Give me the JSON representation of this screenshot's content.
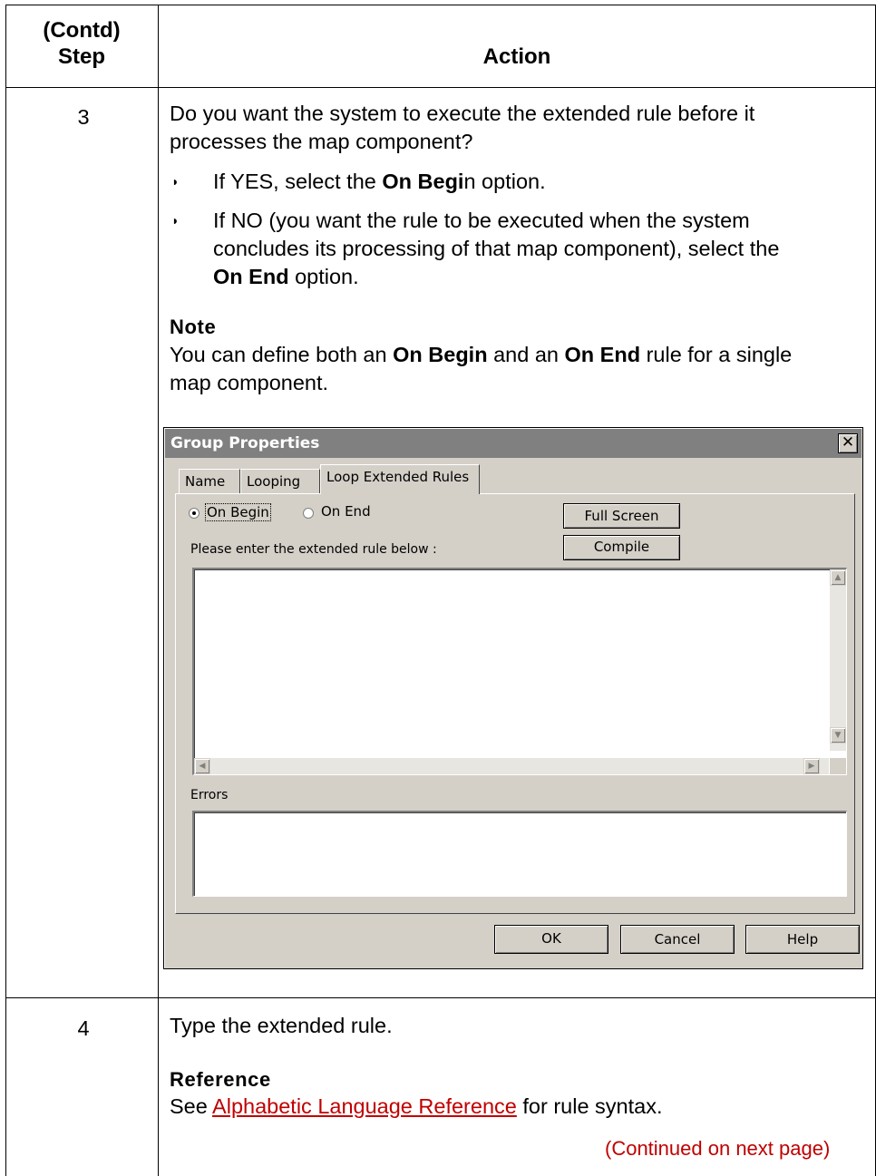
{
  "header": {
    "step_line1": "(Contd)",
    "step_line2": "Step",
    "action": "Action"
  },
  "row3": {
    "step": "3",
    "question_line1": "Do you want the system to execute the extended rule before it",
    "question_line2": "processes the map component?",
    "bullet1": {
      "prefix": "If YES, select the ",
      "bold": "On Begi",
      "suffix": "n option."
    },
    "bullet2": {
      "line1": "If NO (you want the rule to be executed when the system",
      "line2": "concludes its processing of that map component), select the",
      "bold": "On End",
      "suffix": " option."
    },
    "note": {
      "heading": "Note",
      "part1": "You can define both an ",
      "bold1": "On Begin",
      "part2": " and an ",
      "bold2": "On End",
      "part3": " rule for a single",
      "line2": "map component."
    }
  },
  "dialog": {
    "title": "Group Properties",
    "close_glyph": "✕",
    "tabs": [
      "Name",
      "Looping",
      "Loop Extended Rules"
    ],
    "radio_on_begin": "On Begin",
    "radio_on_end": "On End",
    "selected_radio": "On Begin",
    "full_screen_label": "Full Screen",
    "compile_label": "Compile",
    "rule_prompt": "Please enter the extended rule below :",
    "rule_value": "",
    "errors_label": "Errors",
    "errors_value": "",
    "ok_label": "OK",
    "cancel_label": "Cancel",
    "help_label": "Help"
  },
  "row4": {
    "step": "4",
    "text": "Type the extended rule.",
    "reference": {
      "heading": "Reference",
      "prefix": "See ",
      "link": "Alphabetic Language Reference",
      "suffix": " for rule syntax."
    },
    "continued": "(Continued on next page)"
  },
  "colors": {
    "link": "#c00000",
    "dialog_bg": "#d4d0c8",
    "titlebar": "#808080"
  }
}
